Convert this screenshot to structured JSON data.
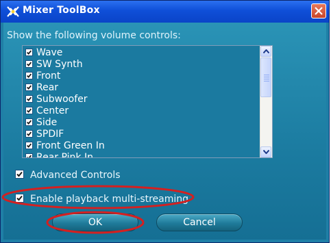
{
  "window": {
    "title": "Mixer ToolBox"
  },
  "section_label": "Show the following volume controls:",
  "volume_controls": [
    {
      "label": "Wave",
      "checked": true
    },
    {
      "label": "SW Synth",
      "checked": true
    },
    {
      "label": "Front",
      "checked": true
    },
    {
      "label": "Rear",
      "checked": true
    },
    {
      "label": "Subwoofer",
      "checked": true
    },
    {
      "label": "Center",
      "checked": true
    },
    {
      "label": "Side",
      "checked": true
    },
    {
      "label": "SPDIF",
      "checked": true
    },
    {
      "label": "Front Green In",
      "checked": true
    },
    {
      "label": "Rear Pink In",
      "checked": true
    }
  ],
  "options": {
    "advanced_controls": {
      "label": "Advanced Controls",
      "checked": true
    },
    "multi_streaming": {
      "label": "Enable playback multi-streaming",
      "checked": true
    }
  },
  "buttons": {
    "ok": "OK",
    "cancel": "Cancel"
  },
  "colors": {
    "annotation_red": "#d42020",
    "title_bar": "#0f4fd8",
    "dialog_bg": "#1b7ba0"
  },
  "icons": {
    "app": "mixer-app-icon",
    "close": "close-x-icon",
    "check": "checkmark-icon",
    "scroll_up": "arrow-up-icon",
    "scroll_down": "arrow-down-icon"
  }
}
